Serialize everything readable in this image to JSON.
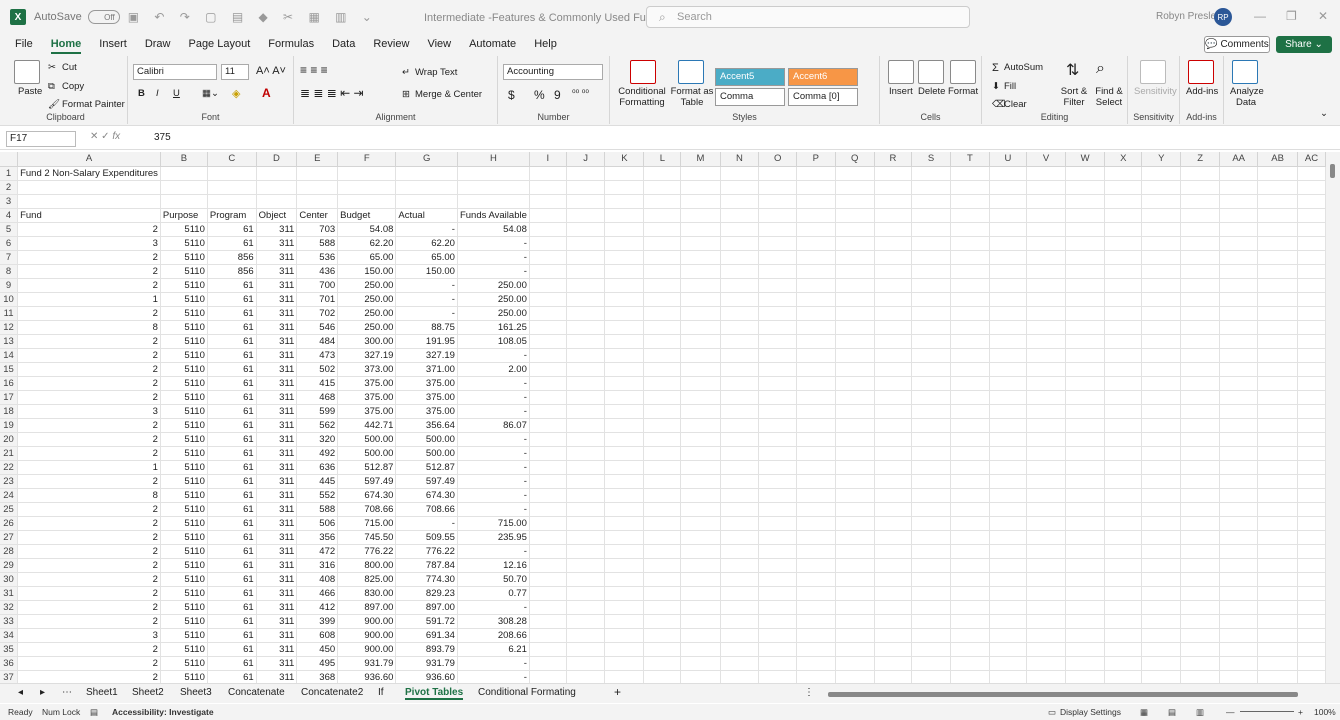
{
  "titlebar": {
    "autosave": "AutoSave",
    "autosave_state": "Off",
    "doc_title": "Intermediate -Features & Commonly Used Funct... ⌄",
    "search_placeholder": "Search",
    "user_name": "Robyn Presley",
    "user_initials": "RP"
  },
  "menu": [
    "File",
    "Home",
    "Insert",
    "Draw",
    "Page Layout",
    "Formulas",
    "Data",
    "Review",
    "View",
    "Automate",
    "Help"
  ],
  "menu_active": "Home",
  "comments_label": "Comments",
  "share_label": "Share",
  "ribbon": {
    "clipboard": {
      "paste": "Paste",
      "cut": "Cut",
      "copy": "Copy",
      "format_painter": "Format Painter",
      "label": "Clipboard"
    },
    "font": {
      "name": "Calibri",
      "size": "11",
      "label": "Font",
      "bold": "B",
      "italic": "I",
      "underline": "U"
    },
    "alignment": {
      "wrap": "Wrap Text",
      "merge": "Merge & Center",
      "label": "Alignment"
    },
    "number": {
      "format": "Accounting",
      "label": "Number",
      "currency": "$",
      "percent": "%",
      "comma": "9"
    },
    "styles": {
      "cond": "Conditional Formatting",
      "table": "Format as Table",
      "accent5": "Accent5",
      "accent6": "Accent6",
      "comma": "Comma",
      "comma0": "Comma [0]",
      "label": "Styles"
    },
    "cells": {
      "insert": "Insert",
      "delete": "Delete",
      "format": "Format",
      "label": "Cells"
    },
    "editing": {
      "autosum": "AutoSum",
      "fill": "Fill",
      "clear": "Clear",
      "sort": "Sort & Filter",
      "find": "Find & Select",
      "label": "Editing"
    },
    "sensitivity": {
      "btn": "Sensitivity",
      "label": "Sensitivity"
    },
    "addins": {
      "btn": "Add-ins",
      "label": "Add-ins"
    },
    "analyze": {
      "btn": "Analyze Data"
    }
  },
  "formula_bar": {
    "name_box": "F17",
    "fx": "fx",
    "value": "375"
  },
  "columns": [
    "A",
    "B",
    "C",
    "D",
    "E",
    "F",
    "G",
    "H",
    "I",
    "J",
    "K",
    "L",
    "M",
    "N",
    "O",
    "P",
    "Q",
    "R",
    "S",
    "T",
    "U",
    "V",
    "W",
    "X",
    "Y",
    "Z",
    "AA",
    "AB",
    "AC"
  ],
  "sheet_title": "Fund 2 Non-Salary Expenditures",
  "headers": [
    "Fund",
    "Purpose",
    "Program",
    "Object",
    "Center",
    "Budget",
    "Actual",
    "Funds Available"
  ],
  "rows": [
    [
      "2",
      "5110",
      "61",
      "311",
      "703",
      "54.08",
      "-",
      "54.08"
    ],
    [
      "3",
      "5110",
      "61",
      "311",
      "588",
      "62.20",
      "62.20",
      "-"
    ],
    [
      "2",
      "5110",
      "856",
      "311",
      "536",
      "65.00",
      "65.00",
      "-"
    ],
    [
      "2",
      "5110",
      "856",
      "311",
      "436",
      "150.00",
      "150.00",
      "-"
    ],
    [
      "2",
      "5110",
      "61",
      "311",
      "700",
      "250.00",
      "-",
      "250.00"
    ],
    [
      "1",
      "5110",
      "61",
      "311",
      "701",
      "250.00",
      "-",
      "250.00"
    ],
    [
      "2",
      "5110",
      "61",
      "311",
      "702",
      "250.00",
      "-",
      "250.00"
    ],
    [
      "8",
      "5110",
      "61",
      "311",
      "546",
      "250.00",
      "88.75",
      "161.25"
    ],
    [
      "2",
      "5110",
      "61",
      "311",
      "484",
      "300.00",
      "191.95",
      "108.05"
    ],
    [
      "2",
      "5110",
      "61",
      "311",
      "473",
      "327.19",
      "327.19",
      "-"
    ],
    [
      "2",
      "5110",
      "61",
      "311",
      "502",
      "373.00",
      "371.00",
      "2.00"
    ],
    [
      "2",
      "5110",
      "61",
      "311",
      "415",
      "375.00",
      "375.00",
      "-"
    ],
    [
      "2",
      "5110",
      "61",
      "311",
      "468",
      "375.00",
      "375.00",
      "-"
    ],
    [
      "3",
      "5110",
      "61",
      "311",
      "599",
      "375.00",
      "375.00",
      "-"
    ],
    [
      "2",
      "5110",
      "61",
      "311",
      "562",
      "442.71",
      "356.64",
      "86.07"
    ],
    [
      "2",
      "5110",
      "61",
      "311",
      "320",
      "500.00",
      "500.00",
      "-"
    ],
    [
      "2",
      "5110",
      "61",
      "311",
      "492",
      "500.00",
      "500.00",
      "-"
    ],
    [
      "1",
      "5110",
      "61",
      "311",
      "636",
      "512.87",
      "512.87",
      "-"
    ],
    [
      "2",
      "5110",
      "61",
      "311",
      "445",
      "597.49",
      "597.49",
      "-"
    ],
    [
      "8",
      "5110",
      "61",
      "311",
      "552",
      "674.30",
      "674.30",
      "-"
    ],
    [
      "2",
      "5110",
      "61",
      "311",
      "588",
      "708.66",
      "708.66",
      "-"
    ],
    [
      "2",
      "5110",
      "61",
      "311",
      "506",
      "715.00",
      "-",
      "715.00"
    ],
    [
      "2",
      "5110",
      "61",
      "311",
      "356",
      "745.50",
      "509.55",
      "235.95"
    ],
    [
      "2",
      "5110",
      "61",
      "311",
      "472",
      "776.22",
      "776.22",
      "-"
    ],
    [
      "2",
      "5110",
      "61",
      "311",
      "316",
      "800.00",
      "787.84",
      "12.16"
    ],
    [
      "2",
      "5110",
      "61",
      "311",
      "408",
      "825.00",
      "774.30",
      "50.70"
    ],
    [
      "2",
      "5110",
      "61",
      "311",
      "466",
      "830.00",
      "829.23",
      "0.77"
    ],
    [
      "2",
      "5110",
      "61",
      "311",
      "412",
      "897.00",
      "897.00",
      "-"
    ],
    [
      "2",
      "5110",
      "61",
      "311",
      "399",
      "900.00",
      "591.72",
      "308.28"
    ],
    [
      "3",
      "5110",
      "61",
      "311",
      "608",
      "900.00",
      "691.34",
      "208.66"
    ],
    [
      "2",
      "5110",
      "61",
      "311",
      "450",
      "900.00",
      "893.79",
      "6.21"
    ],
    [
      "2",
      "5110",
      "61",
      "311",
      "495",
      "931.79",
      "931.79",
      "-"
    ],
    [
      "2",
      "5110",
      "61",
      "311",
      "368",
      "936.60",
      "936.60",
      "-"
    ]
  ],
  "tabs": [
    "Sheet1",
    "Sheet2",
    "Sheet3",
    "Concatenate",
    "Concatenate2",
    "If",
    "Pivot Tables",
    "Conditional Formating"
  ],
  "active_tab": "Pivot Tables",
  "status": {
    "ready": "Ready",
    "numlock": "Num Lock",
    "accessibility": "Accessibility: Investigate",
    "display": "Display Settings",
    "zoom": "100%"
  }
}
